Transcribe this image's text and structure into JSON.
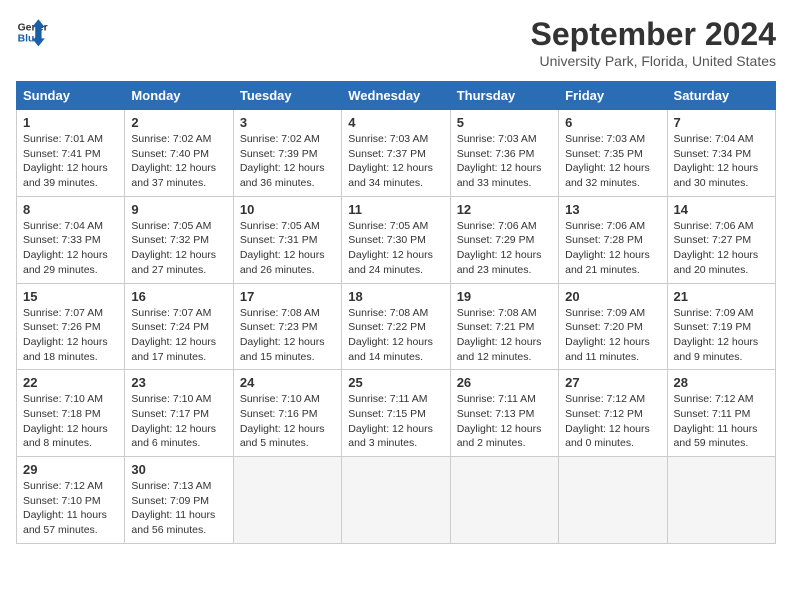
{
  "header": {
    "logo_line1": "General",
    "logo_line2": "Blue",
    "month": "September 2024",
    "location": "University Park, Florida, United States"
  },
  "weekdays": [
    "Sunday",
    "Monday",
    "Tuesday",
    "Wednesday",
    "Thursday",
    "Friday",
    "Saturday"
  ],
  "weeks": [
    [
      {
        "day": "1",
        "info": "Sunrise: 7:01 AM\nSunset: 7:41 PM\nDaylight: 12 hours\nand 39 minutes."
      },
      {
        "day": "2",
        "info": "Sunrise: 7:02 AM\nSunset: 7:40 PM\nDaylight: 12 hours\nand 37 minutes."
      },
      {
        "day": "3",
        "info": "Sunrise: 7:02 AM\nSunset: 7:39 PM\nDaylight: 12 hours\nand 36 minutes."
      },
      {
        "day": "4",
        "info": "Sunrise: 7:03 AM\nSunset: 7:37 PM\nDaylight: 12 hours\nand 34 minutes."
      },
      {
        "day": "5",
        "info": "Sunrise: 7:03 AM\nSunset: 7:36 PM\nDaylight: 12 hours\nand 33 minutes."
      },
      {
        "day": "6",
        "info": "Sunrise: 7:03 AM\nSunset: 7:35 PM\nDaylight: 12 hours\nand 32 minutes."
      },
      {
        "day": "7",
        "info": "Sunrise: 7:04 AM\nSunset: 7:34 PM\nDaylight: 12 hours\nand 30 minutes."
      }
    ],
    [
      {
        "day": "8",
        "info": "Sunrise: 7:04 AM\nSunset: 7:33 PM\nDaylight: 12 hours\nand 29 minutes."
      },
      {
        "day": "9",
        "info": "Sunrise: 7:05 AM\nSunset: 7:32 PM\nDaylight: 12 hours\nand 27 minutes."
      },
      {
        "day": "10",
        "info": "Sunrise: 7:05 AM\nSunset: 7:31 PM\nDaylight: 12 hours\nand 26 minutes."
      },
      {
        "day": "11",
        "info": "Sunrise: 7:05 AM\nSunset: 7:30 PM\nDaylight: 12 hours\nand 24 minutes."
      },
      {
        "day": "12",
        "info": "Sunrise: 7:06 AM\nSunset: 7:29 PM\nDaylight: 12 hours\nand 23 minutes."
      },
      {
        "day": "13",
        "info": "Sunrise: 7:06 AM\nSunset: 7:28 PM\nDaylight: 12 hours\nand 21 minutes."
      },
      {
        "day": "14",
        "info": "Sunrise: 7:06 AM\nSunset: 7:27 PM\nDaylight: 12 hours\nand 20 minutes."
      }
    ],
    [
      {
        "day": "15",
        "info": "Sunrise: 7:07 AM\nSunset: 7:26 PM\nDaylight: 12 hours\nand 18 minutes."
      },
      {
        "day": "16",
        "info": "Sunrise: 7:07 AM\nSunset: 7:24 PM\nDaylight: 12 hours\nand 17 minutes."
      },
      {
        "day": "17",
        "info": "Sunrise: 7:08 AM\nSunset: 7:23 PM\nDaylight: 12 hours\nand 15 minutes."
      },
      {
        "day": "18",
        "info": "Sunrise: 7:08 AM\nSunset: 7:22 PM\nDaylight: 12 hours\nand 14 minutes."
      },
      {
        "day": "19",
        "info": "Sunrise: 7:08 AM\nSunset: 7:21 PM\nDaylight: 12 hours\nand 12 minutes."
      },
      {
        "day": "20",
        "info": "Sunrise: 7:09 AM\nSunset: 7:20 PM\nDaylight: 12 hours\nand 11 minutes."
      },
      {
        "day": "21",
        "info": "Sunrise: 7:09 AM\nSunset: 7:19 PM\nDaylight: 12 hours\nand 9 minutes."
      }
    ],
    [
      {
        "day": "22",
        "info": "Sunrise: 7:10 AM\nSunset: 7:18 PM\nDaylight: 12 hours\nand 8 minutes."
      },
      {
        "day": "23",
        "info": "Sunrise: 7:10 AM\nSunset: 7:17 PM\nDaylight: 12 hours\nand 6 minutes."
      },
      {
        "day": "24",
        "info": "Sunrise: 7:10 AM\nSunset: 7:16 PM\nDaylight: 12 hours\nand 5 minutes."
      },
      {
        "day": "25",
        "info": "Sunrise: 7:11 AM\nSunset: 7:15 PM\nDaylight: 12 hours\nand 3 minutes."
      },
      {
        "day": "26",
        "info": "Sunrise: 7:11 AM\nSunset: 7:13 PM\nDaylight: 12 hours\nand 2 minutes."
      },
      {
        "day": "27",
        "info": "Sunrise: 7:12 AM\nSunset: 7:12 PM\nDaylight: 12 hours\nand 0 minutes."
      },
      {
        "day": "28",
        "info": "Sunrise: 7:12 AM\nSunset: 7:11 PM\nDaylight: 11 hours\nand 59 minutes."
      }
    ],
    [
      {
        "day": "29",
        "info": "Sunrise: 7:12 AM\nSunset: 7:10 PM\nDaylight: 11 hours\nand 57 minutes."
      },
      {
        "day": "30",
        "info": "Sunrise: 7:13 AM\nSunset: 7:09 PM\nDaylight: 11 hours\nand 56 minutes."
      },
      {
        "day": "",
        "info": ""
      },
      {
        "day": "",
        "info": ""
      },
      {
        "day": "",
        "info": ""
      },
      {
        "day": "",
        "info": ""
      },
      {
        "day": "",
        "info": ""
      }
    ]
  ]
}
